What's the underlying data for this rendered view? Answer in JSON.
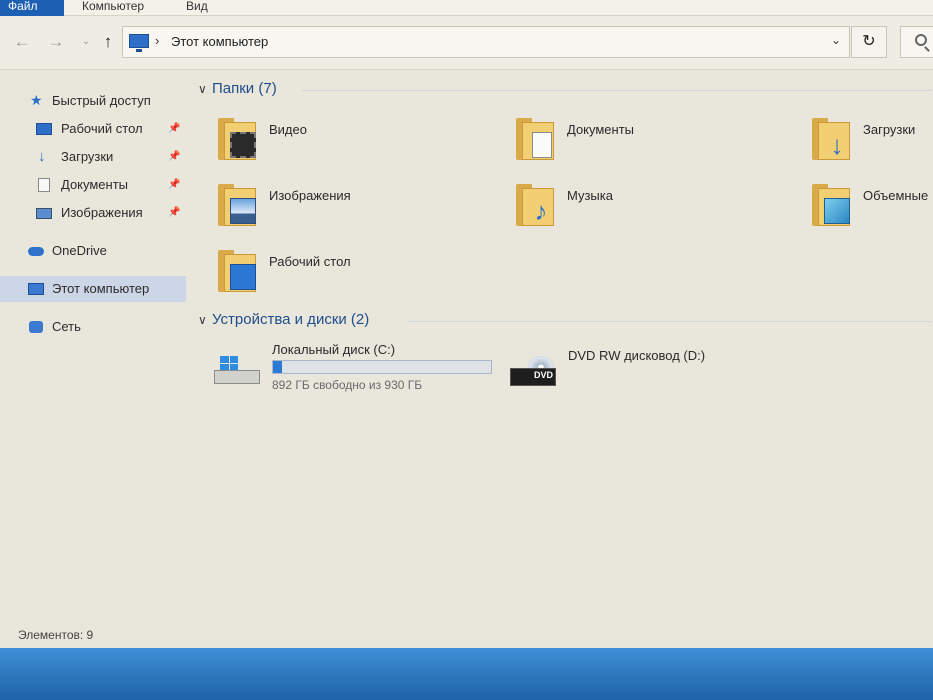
{
  "ribbon": {
    "tabs": [
      "Файл",
      "Компьютер",
      "Вид"
    ]
  },
  "address": {
    "path": "Этот компьютер"
  },
  "nav": {
    "quick_access": "Быстрый доступ",
    "pinned": [
      {
        "label": "Рабочий стол",
        "icon": "desktop-icon"
      },
      {
        "label": "Загрузки",
        "icon": "downloads-icon"
      },
      {
        "label": "Документы",
        "icon": "documents-icon"
      },
      {
        "label": "Изображения",
        "icon": "pictures-icon"
      }
    ],
    "onedrive": "OneDrive",
    "this_pc": "Этот компьютер",
    "network": "Сеть"
  },
  "folders_group": {
    "title": "Папки (7)",
    "items": [
      {
        "label": "Видео",
        "icon": "videos-folder-icon"
      },
      {
        "label": "Документы",
        "icon": "documents-folder-icon"
      },
      {
        "label": "Загрузки",
        "icon": "downloads-folder-icon"
      },
      {
        "label": "Изображения",
        "icon": "pictures-folder-icon"
      },
      {
        "label": "Музыка",
        "icon": "music-folder-icon"
      },
      {
        "label": "Объемные",
        "icon": "3d-objects-folder-icon"
      },
      {
        "label": "Рабочий стол",
        "icon": "desktop-folder-icon"
      }
    ]
  },
  "drives_group": {
    "title": "Устройства и диски (2)",
    "drives": [
      {
        "label": "Локальный диск (C:)",
        "free_text": "892 ГБ свободно из 930 ГБ",
        "used_fraction": 0.041
      },
      {
        "label": "DVD RW дисковод (D:)",
        "badge": "DVD"
      }
    ]
  },
  "status": {
    "items_text": "Элементов: 9"
  },
  "colors": {
    "accent": "#1d5fb3",
    "selection": "#cdd6e6",
    "group_header": "#1f4e8c"
  }
}
